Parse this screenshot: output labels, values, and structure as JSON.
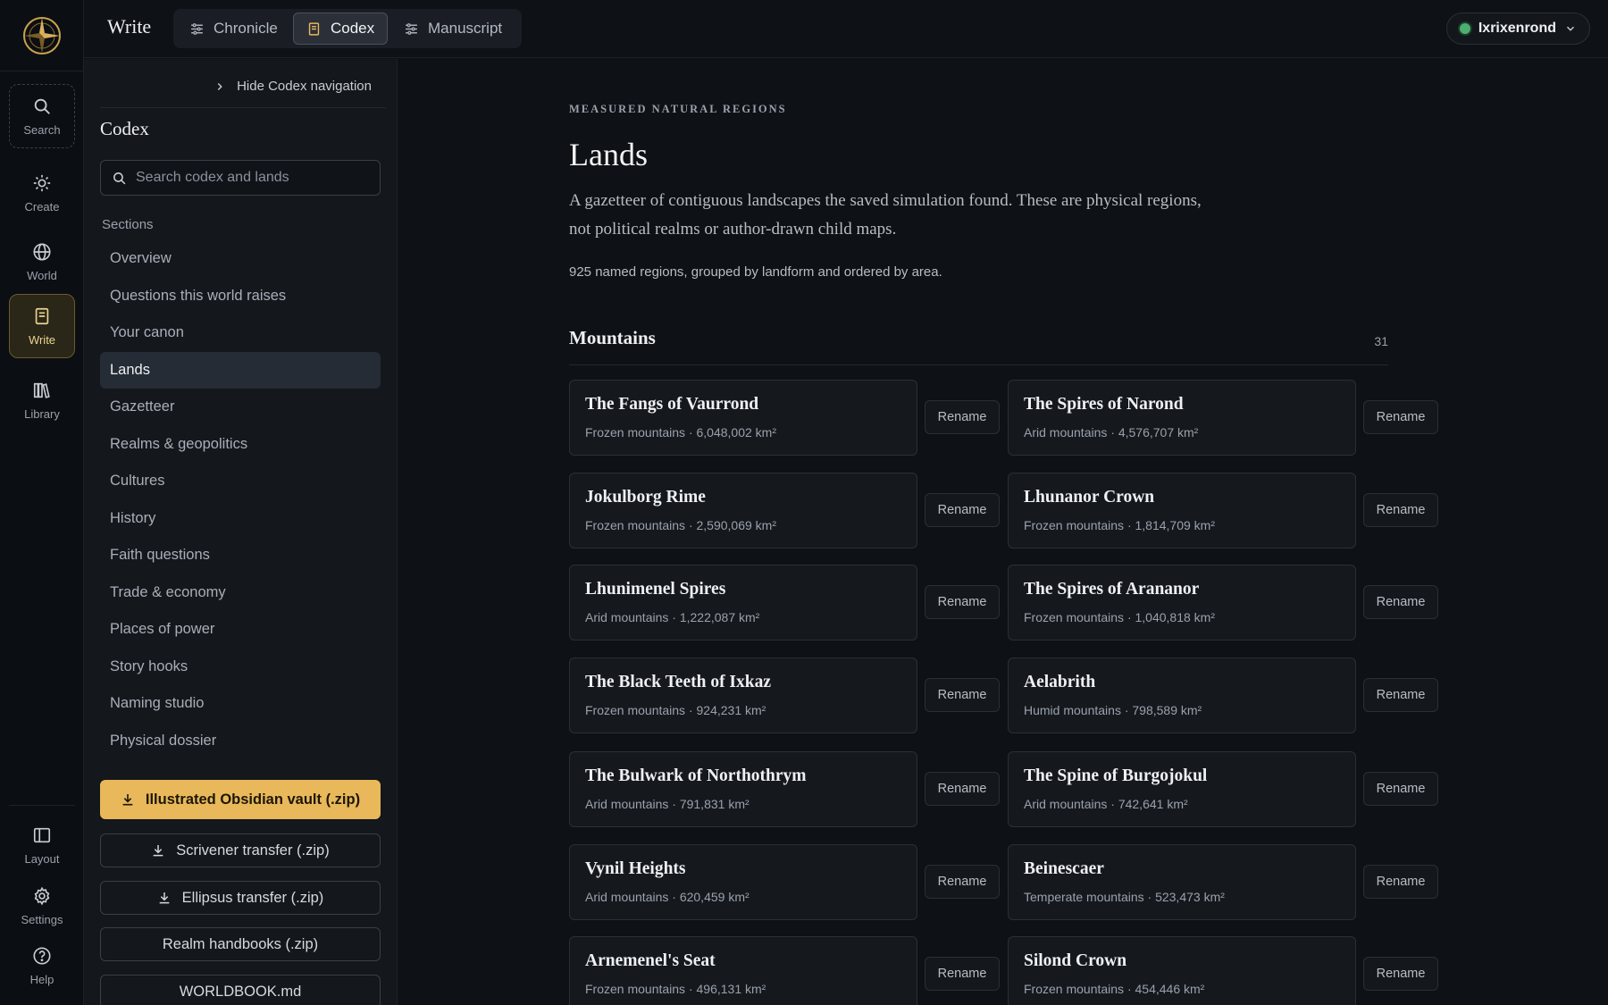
{
  "app": {
    "title": "Write"
  },
  "tabs": [
    {
      "label": "Chronicle",
      "icon": "sliders-icon"
    },
    {
      "label": "Codex",
      "icon": "book-icon",
      "active": true
    },
    {
      "label": "Manuscript",
      "icon": "sliders-icon"
    }
  ],
  "user": {
    "name": "Ixrixenrond",
    "status_color": "#4caf70"
  },
  "rail": {
    "top": [
      {
        "label": "Search",
        "icon": "search-icon"
      },
      {
        "label": "Create",
        "icon": "sparkle-icon"
      },
      {
        "label": "World",
        "icon": "globe-icon"
      },
      {
        "label": "Write",
        "icon": "notebook-icon",
        "active": true
      },
      {
        "label": "Library",
        "icon": "books-icon"
      }
    ],
    "bottom": [
      {
        "label": "Layout",
        "icon": "layout-icon"
      },
      {
        "label": "Settings",
        "icon": "gear-icon"
      },
      {
        "label": "Help",
        "icon": "help-icon"
      }
    ]
  },
  "sidebar": {
    "hide_label": "Hide Codex navigation",
    "title": "Codex",
    "search_placeholder": "Search codex and lands",
    "sections_label": "Sections",
    "items": [
      "Overview",
      "Questions this world raises",
      "Your canon",
      "Lands",
      "Gazetteer",
      "Realms & geopolitics",
      "Cultures",
      "History",
      "Faith questions",
      "Trade & economy",
      "Places of power",
      "Story hooks",
      "Naming studio",
      "Physical dossier"
    ],
    "active_item": "Lands",
    "exports": [
      {
        "label": "Illustrated Obsidian vault (.zip)",
        "primary": true,
        "download": true
      },
      {
        "label": "Scrivener transfer (.zip)",
        "download": true
      },
      {
        "label": "Ellipsus transfer (.zip)",
        "download": true
      },
      {
        "label": "Realm handbooks (.zip)",
        "download": false
      },
      {
        "label": "WORLDBOOK.md",
        "download": false
      }
    ]
  },
  "main": {
    "eyebrow": "MEASURED NATURAL REGIONS",
    "title": "Lands",
    "lede": "A gazetteer of contiguous landscapes the saved simulation found. These are physical regions, not political realms or author-drawn child maps.",
    "summary": "925 named regions, grouped by landform and ordered by area.",
    "group": {
      "title": "Mountains",
      "count": "31"
    },
    "rename_label": "Rename",
    "regions": [
      {
        "name": "The Fangs of Vaurrond",
        "meta": "Frozen mountains · 6,048,002 km²"
      },
      {
        "name": "The Spires of Narond",
        "meta": "Arid mountains · 4,576,707 km²"
      },
      {
        "name": "Jokulborg Rime",
        "meta": "Frozen mountains · 2,590,069 km²"
      },
      {
        "name": "Lhunanor Crown",
        "meta": "Frozen mountains · 1,814,709 km²"
      },
      {
        "name": "Lhunimenel Spires",
        "meta": "Arid mountains · 1,222,087 km²"
      },
      {
        "name": "The Spires of Arananor",
        "meta": "Frozen mountains · 1,040,818 km²"
      },
      {
        "name": "The Black Teeth of Ixkaz",
        "meta": "Frozen mountains · 924,231 km²"
      },
      {
        "name": "Aelabrith",
        "meta": "Humid mountains · 798,589 km²"
      },
      {
        "name": "The Bulwark of Northothrym",
        "meta": "Arid mountains · 791,831 km²"
      },
      {
        "name": "The Spine of Burgojokul",
        "meta": "Arid mountains · 742,641 km²"
      },
      {
        "name": "Vynil Heights",
        "meta": "Arid mountains · 620,459 km²"
      },
      {
        "name": "Beinescaer",
        "meta": "Temperate mountains · 523,473 km²"
      },
      {
        "name": "Arnemenel's Seat",
        "meta": "Frozen mountains · 496,131 km²"
      },
      {
        "name": "Silond Crown",
        "meta": "Frozen mountains · 454,446 km²"
      }
    ]
  },
  "colors": {
    "accent": "#e9b85a",
    "background": "#0e1115",
    "panel": "#14171c"
  }
}
